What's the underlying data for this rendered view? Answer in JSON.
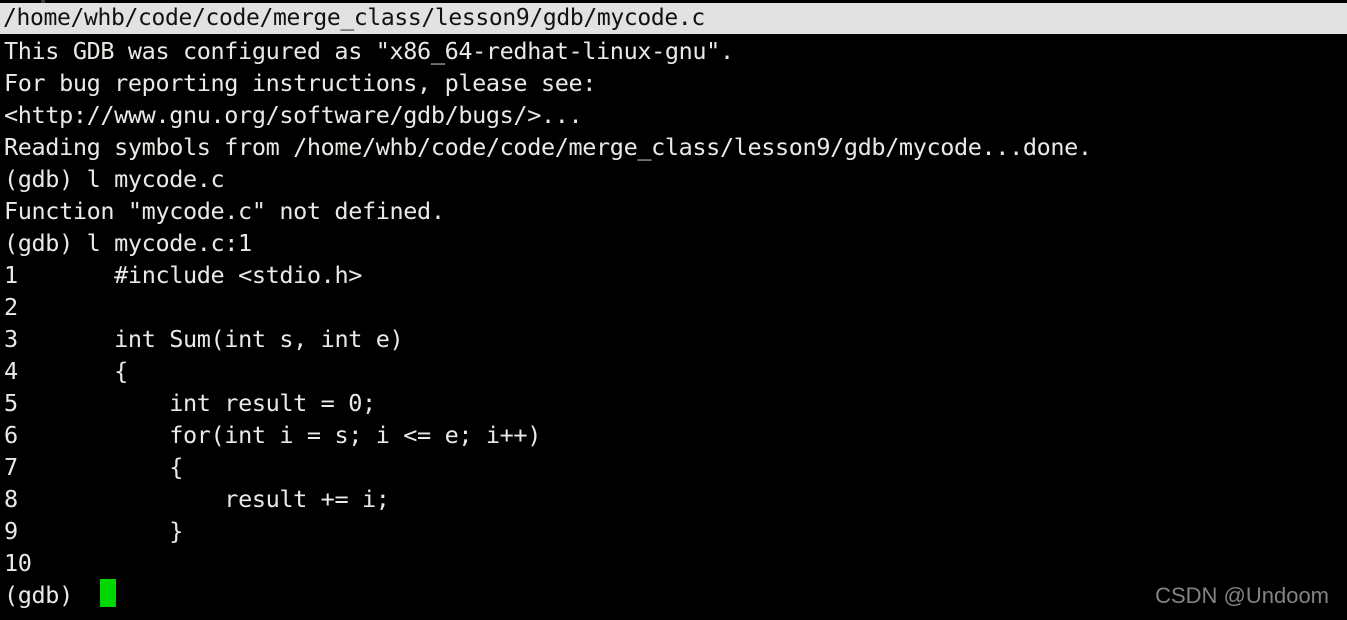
{
  "window": {
    "title": "/home/whb/code/code/merge_class/lesson9/gdb/mycode.c",
    "titlebar_bg": "#e2e2e2",
    "titlebar_fg": "#111111"
  },
  "terminal": {
    "bg": "#000000",
    "fg": "#e9e9e6",
    "cursor_color": "#00d700",
    "lines": [
      "This GDB was configured as \"x86_64-redhat-linux-gnu\".",
      "For bug reporting instructions, please see:",
      "<http://www.gnu.org/software/gdb/bugs/>...",
      "Reading symbols from /home/whb/code/code/merge_class/lesson9/gdb/mycode...done.",
      "(gdb) l mycode.c",
      "Function \"mycode.c\" not defined.",
      "(gdb) l mycode.c:1"
    ],
    "listing": [
      {
        "number": "1",
        "code": "        #include <stdio.h>"
      },
      {
        "number": "2",
        "code": ""
      },
      {
        "number": "3",
        "code": "        int Sum(int s, int e)"
      },
      {
        "number": "4",
        "code": "        {"
      },
      {
        "number": "5",
        "code": "            int result = 0;"
      },
      {
        "number": "6",
        "code": "            for(int i = s; i <= e; i++)"
      },
      {
        "number": "7",
        "code": "            {"
      },
      {
        "number": "8",
        "code": "                result += i;"
      },
      {
        "number": "9",
        "code": "            }"
      },
      {
        "number": "10",
        "code": ""
      }
    ],
    "prompt": "(gdb) "
  },
  "watermark": {
    "text": "CSDN @Undoom",
    "color": "#9b9b9b"
  }
}
